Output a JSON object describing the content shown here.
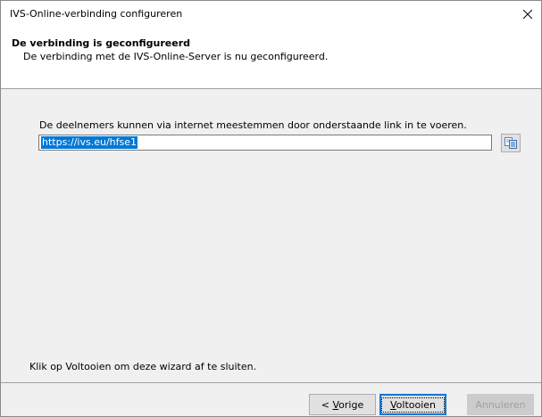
{
  "window": {
    "title": "IVS-Online-verbinding configureren"
  },
  "header": {
    "title": "De verbinding is geconfigureerd",
    "subtitle": "De verbinding met de IVS-Online-Server is nu geconfigureerd."
  },
  "content": {
    "instruction": "De deelnemers kunnen via internet meestemmen door onderstaande link in te voeren.",
    "link_value": "https://ivs.eu/hfse1",
    "finish_hint": "Klik op Voltooien om deze wizard af te sluiten."
  },
  "buttons": {
    "prev_label_pre": "< ",
    "prev_label_mn": "V",
    "prev_label_post": "orige",
    "finish_label_mn": "V",
    "finish_label_post": "oltooien",
    "cancel_label": "Annuleren"
  },
  "icons": {
    "close": "close-icon",
    "copy": "copy-icon"
  },
  "colors": {
    "selection": "#0078d7",
    "default_button_border": "#0078d7"
  }
}
